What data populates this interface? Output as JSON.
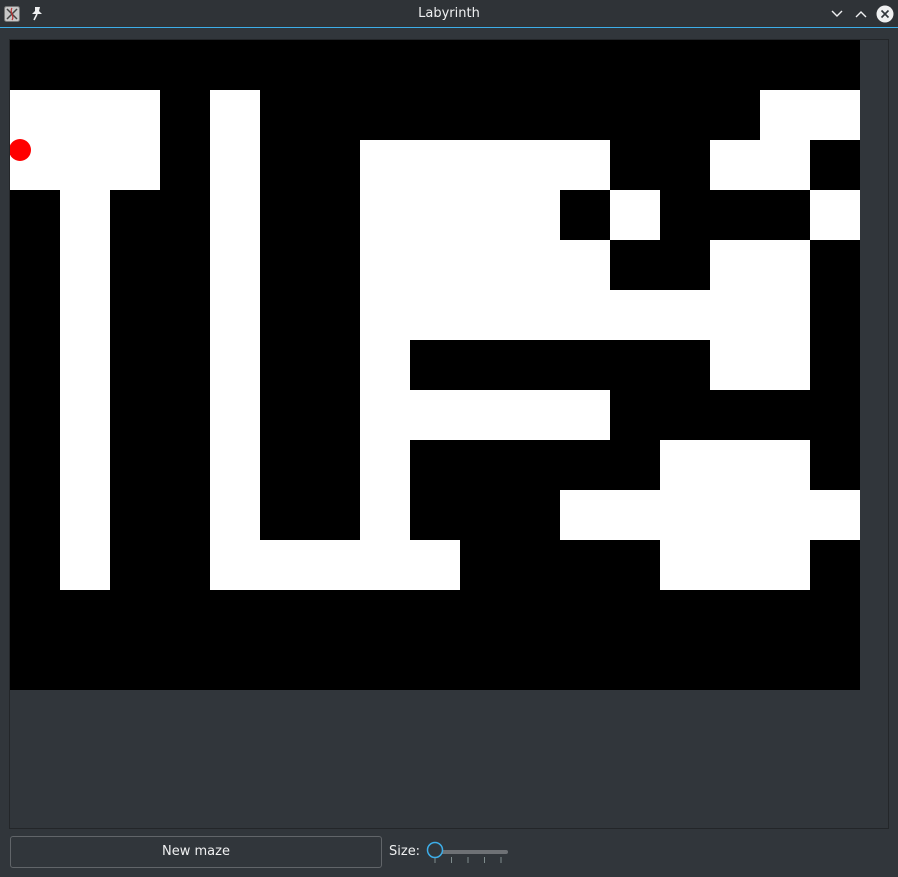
{
  "window": {
    "title": "Labyrinth",
    "icons": {
      "app": "app-icon",
      "pin": "pin-icon",
      "minimize": "chevron-down-icon",
      "maximize": "chevron-up-icon",
      "close": "close-icon"
    }
  },
  "maze": {
    "grid_cols": 17,
    "grid_rows": 13,
    "rows": [
      "#################",
      "...#.##########..",
      "...#.##.....##..#",
      "#.##.##....#.###.",
      "#.##.##.....##..#",
      "#.##.##.........",
      "#.##.##.######..#",
      "#.##.##.....#####",
      "#.##.##.#####...#",
      "#.##.##.###......",
      "#.##.....####...#",
      "#################",
      "#################"
    ],
    "player": {
      "col": 0,
      "row": 1
    },
    "colors": {
      "wall": "#000000",
      "path": "#ffffff",
      "player": "#ff0000",
      "background": "#31363b"
    }
  },
  "controls": {
    "new_maze_label": "New maze",
    "size_label": "Size:",
    "size_slider": {
      "value": 0,
      "tick_count": 5
    },
    "accent_color": "#3daee9"
  }
}
